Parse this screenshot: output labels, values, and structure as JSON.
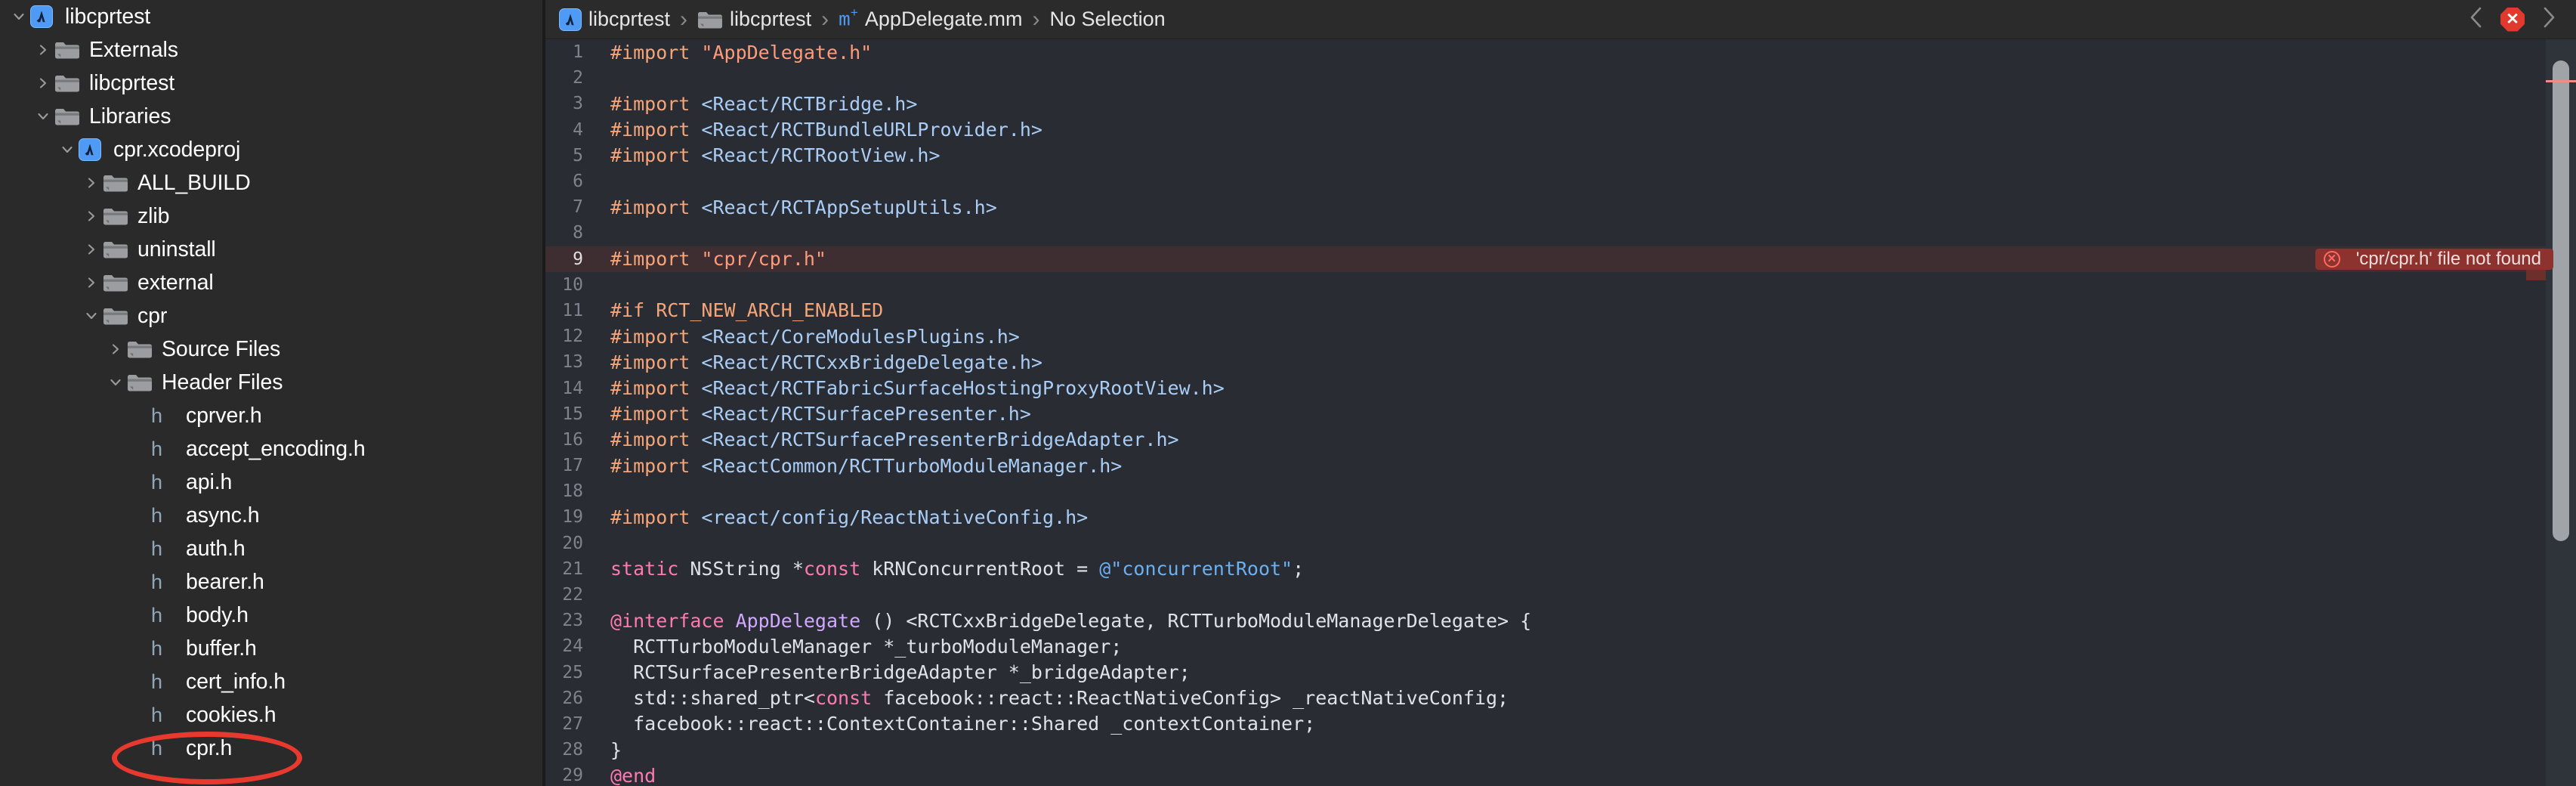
{
  "sidebar": {
    "items": [
      {
        "label": "libcprtest",
        "icon": "xcode-project-icon",
        "twisty": "down",
        "depth": 0
      },
      {
        "label": "Externals",
        "icon": "folder-icon",
        "twisty": "right",
        "depth": 1
      },
      {
        "label": "libcprtest",
        "icon": "folder-icon",
        "twisty": "right",
        "depth": 1
      },
      {
        "label": "Libraries",
        "icon": "folder-icon",
        "twisty": "down",
        "depth": 1
      },
      {
        "label": "cpr.xcodeproj",
        "icon": "xcode-project-icon",
        "twisty": "down",
        "depth": 2
      },
      {
        "label": "ALL_BUILD",
        "icon": "folder-icon",
        "twisty": "right",
        "depth": 3
      },
      {
        "label": "zlib",
        "icon": "folder-icon",
        "twisty": "right",
        "depth": 3
      },
      {
        "label": "uninstall",
        "icon": "folder-icon",
        "twisty": "right",
        "depth": 3
      },
      {
        "label": "external",
        "icon": "folder-icon",
        "twisty": "right",
        "depth": 3
      },
      {
        "label": "cpr",
        "icon": "folder-icon",
        "twisty": "down",
        "depth": 3
      },
      {
        "label": "Source Files",
        "icon": "folder-icon",
        "twisty": "right",
        "depth": 4
      },
      {
        "label": "Header Files",
        "icon": "folder-icon",
        "twisty": "down",
        "depth": 4
      },
      {
        "label": "cprver.h",
        "icon": "header-file-icon",
        "twisty": "none",
        "depth": 5
      },
      {
        "label": "accept_encoding.h",
        "icon": "header-file-icon",
        "twisty": "none",
        "depth": 5
      },
      {
        "label": "api.h",
        "icon": "header-file-icon",
        "twisty": "none",
        "depth": 5
      },
      {
        "label": "async.h",
        "icon": "header-file-icon",
        "twisty": "none",
        "depth": 5
      },
      {
        "label": "auth.h",
        "icon": "header-file-icon",
        "twisty": "none",
        "depth": 5
      },
      {
        "label": "bearer.h",
        "icon": "header-file-icon",
        "twisty": "none",
        "depth": 5
      },
      {
        "label": "body.h",
        "icon": "header-file-icon",
        "twisty": "none",
        "depth": 5
      },
      {
        "label": "buffer.h",
        "icon": "header-file-icon",
        "twisty": "none",
        "depth": 5
      },
      {
        "label": "cert_info.h",
        "icon": "header-file-icon",
        "twisty": "none",
        "depth": 5
      },
      {
        "label": "cookies.h",
        "icon": "header-file-icon",
        "twisty": "none",
        "depth": 5
      },
      {
        "label": "cpr.h",
        "icon": "header-file-icon",
        "twisty": "none",
        "depth": 5
      }
    ],
    "annotation": {
      "shape": "ellipse",
      "color": "#e8392e",
      "targets": "cpr.h"
    }
  },
  "jumpbar": {
    "crumbs": [
      {
        "label": "libcprtest",
        "icon": "xcode-project-icon"
      },
      {
        "label": "libcprtest",
        "icon": "folder-icon"
      },
      {
        "label": "AppDelegate.mm",
        "icon": "objcpp-file-icon"
      },
      {
        "label": "No Selection",
        "icon": "none"
      }
    ],
    "separator": "›",
    "back_icon": "chevron-left-icon",
    "forward_icon": "chevron-right-icon",
    "error_badge_icon": "error-octagon-icon",
    "error_badge_glyph": "✕"
  },
  "editor": {
    "error_banner": {
      "message": "'cpr/cpr.h' file not found",
      "icon": "error-circle-icon",
      "glyph": "✕",
      "on_line": 9,
      "color": "#8c3330"
    },
    "lines": [
      {
        "n": 1,
        "tokens": [
          {
            "t": "#import ",
            "c": "pp"
          },
          {
            "t": "\"AppDelegate.h\"",
            "c": "str"
          }
        ]
      },
      {
        "n": 2,
        "tokens": []
      },
      {
        "n": 3,
        "tokens": [
          {
            "t": "#import ",
            "c": "pp"
          },
          {
            "t": "<React/RCTBridge.h>",
            "c": "hdr"
          }
        ]
      },
      {
        "n": 4,
        "tokens": [
          {
            "t": "#import ",
            "c": "pp"
          },
          {
            "t": "<React/RCTBundleURLProvider.h>",
            "c": "hdr"
          }
        ]
      },
      {
        "n": 5,
        "tokens": [
          {
            "t": "#import ",
            "c": "pp"
          },
          {
            "t": "<React/RCTRootView.h>",
            "c": "hdr"
          }
        ]
      },
      {
        "n": 6,
        "tokens": []
      },
      {
        "n": 7,
        "tokens": [
          {
            "t": "#import ",
            "c": "pp"
          },
          {
            "t": "<React/RCTAppSetupUtils.h>",
            "c": "hdr"
          }
        ]
      },
      {
        "n": 8,
        "tokens": []
      },
      {
        "n": 9,
        "error": true,
        "tokens": [
          {
            "t": "#import ",
            "c": "pp"
          },
          {
            "t": "\"cpr/cpr.h\"",
            "c": "str"
          }
        ]
      },
      {
        "n": 10,
        "tokens": []
      },
      {
        "n": 11,
        "tokens": [
          {
            "t": "#if RCT_NEW_ARCH_ENABLED",
            "c": "pp"
          }
        ]
      },
      {
        "n": 12,
        "tokens": [
          {
            "t": "#import ",
            "c": "pp"
          },
          {
            "t": "<React/CoreModulesPlugins.h>",
            "c": "hdr"
          }
        ]
      },
      {
        "n": 13,
        "tokens": [
          {
            "t": "#import ",
            "c": "pp"
          },
          {
            "t": "<React/RCTCxxBridgeDelegate.h>",
            "c": "hdr"
          }
        ]
      },
      {
        "n": 14,
        "tokens": [
          {
            "t": "#import ",
            "c": "pp"
          },
          {
            "t": "<React/RCTFabricSurfaceHostingProxyRootView.h>",
            "c": "hdr"
          }
        ]
      },
      {
        "n": 15,
        "tokens": [
          {
            "t": "#import ",
            "c": "pp"
          },
          {
            "t": "<React/RCTSurfacePresenter.h>",
            "c": "hdr"
          }
        ]
      },
      {
        "n": 16,
        "tokens": [
          {
            "t": "#import ",
            "c": "pp"
          },
          {
            "t": "<React/RCTSurfacePresenterBridgeAdapter.h>",
            "c": "hdr"
          }
        ]
      },
      {
        "n": 17,
        "tokens": [
          {
            "t": "#import ",
            "c": "pp"
          },
          {
            "t": "<ReactCommon/RCTTurboModuleManager.h>",
            "c": "hdr"
          }
        ]
      },
      {
        "n": 18,
        "tokens": []
      },
      {
        "n": 19,
        "tokens": [
          {
            "t": "#import ",
            "c": "pp"
          },
          {
            "t": "<react/config/ReactNativeConfig.h>",
            "c": "hdr"
          }
        ]
      },
      {
        "n": 20,
        "tokens": []
      },
      {
        "n": 21,
        "tokens": [
          {
            "t": "static",
            "c": "kw"
          },
          {
            "t": " NSString *",
            "c": "plain"
          },
          {
            "t": "const",
            "c": "kw"
          },
          {
            "t": " kRNConcurrentRoot = ",
            "c": "plain"
          },
          {
            "t": "@\"concurrentRoot\"",
            "c": "objstr"
          },
          {
            "t": ";",
            "c": "plain"
          }
        ]
      },
      {
        "n": 22,
        "tokens": []
      },
      {
        "n": 23,
        "tokens": [
          {
            "t": "@interface ",
            "c": "kw"
          },
          {
            "t": "AppDelegate",
            "c": "cls"
          },
          {
            "t": " () <RCTCxxBridgeDelegate, RCTTurboModuleManagerDelegate> {",
            "c": "plain"
          }
        ]
      },
      {
        "n": 24,
        "tokens": [
          {
            "t": "  RCTTurboModuleManager *_turboModuleManager;",
            "c": "plain"
          }
        ]
      },
      {
        "n": 25,
        "tokens": [
          {
            "t": "  RCTSurfacePresenterBridgeAdapter *_bridgeAdapter;",
            "c": "plain"
          }
        ]
      },
      {
        "n": 26,
        "tokens": [
          {
            "t": "  std::shared_ptr<",
            "c": "plain"
          },
          {
            "t": "const",
            "c": "kw"
          },
          {
            "t": " facebook::react::ReactNativeConfig> _reactNativeConfig;",
            "c": "plain"
          }
        ]
      },
      {
        "n": 27,
        "tokens": [
          {
            "t": "  facebook::react::ContextContainer::Shared _contextContainer;",
            "c": "plain"
          }
        ]
      },
      {
        "n": 28,
        "tokens": [
          {
            "t": "}",
            "c": "plain"
          }
        ]
      },
      {
        "n": 29,
        "tokens": [
          {
            "t": "@end",
            "c": "kw"
          }
        ]
      }
    ]
  },
  "colors": {
    "sidebar_bg": "#2a2a2a",
    "editor_bg": "#292c33",
    "jumpbar_bg": "#2b2b2b",
    "error_red": "#e0392e",
    "error_line_bg": "#3e2e31",
    "accent_blue": "#4e9af5",
    "annotation_red": "#e8392e"
  }
}
